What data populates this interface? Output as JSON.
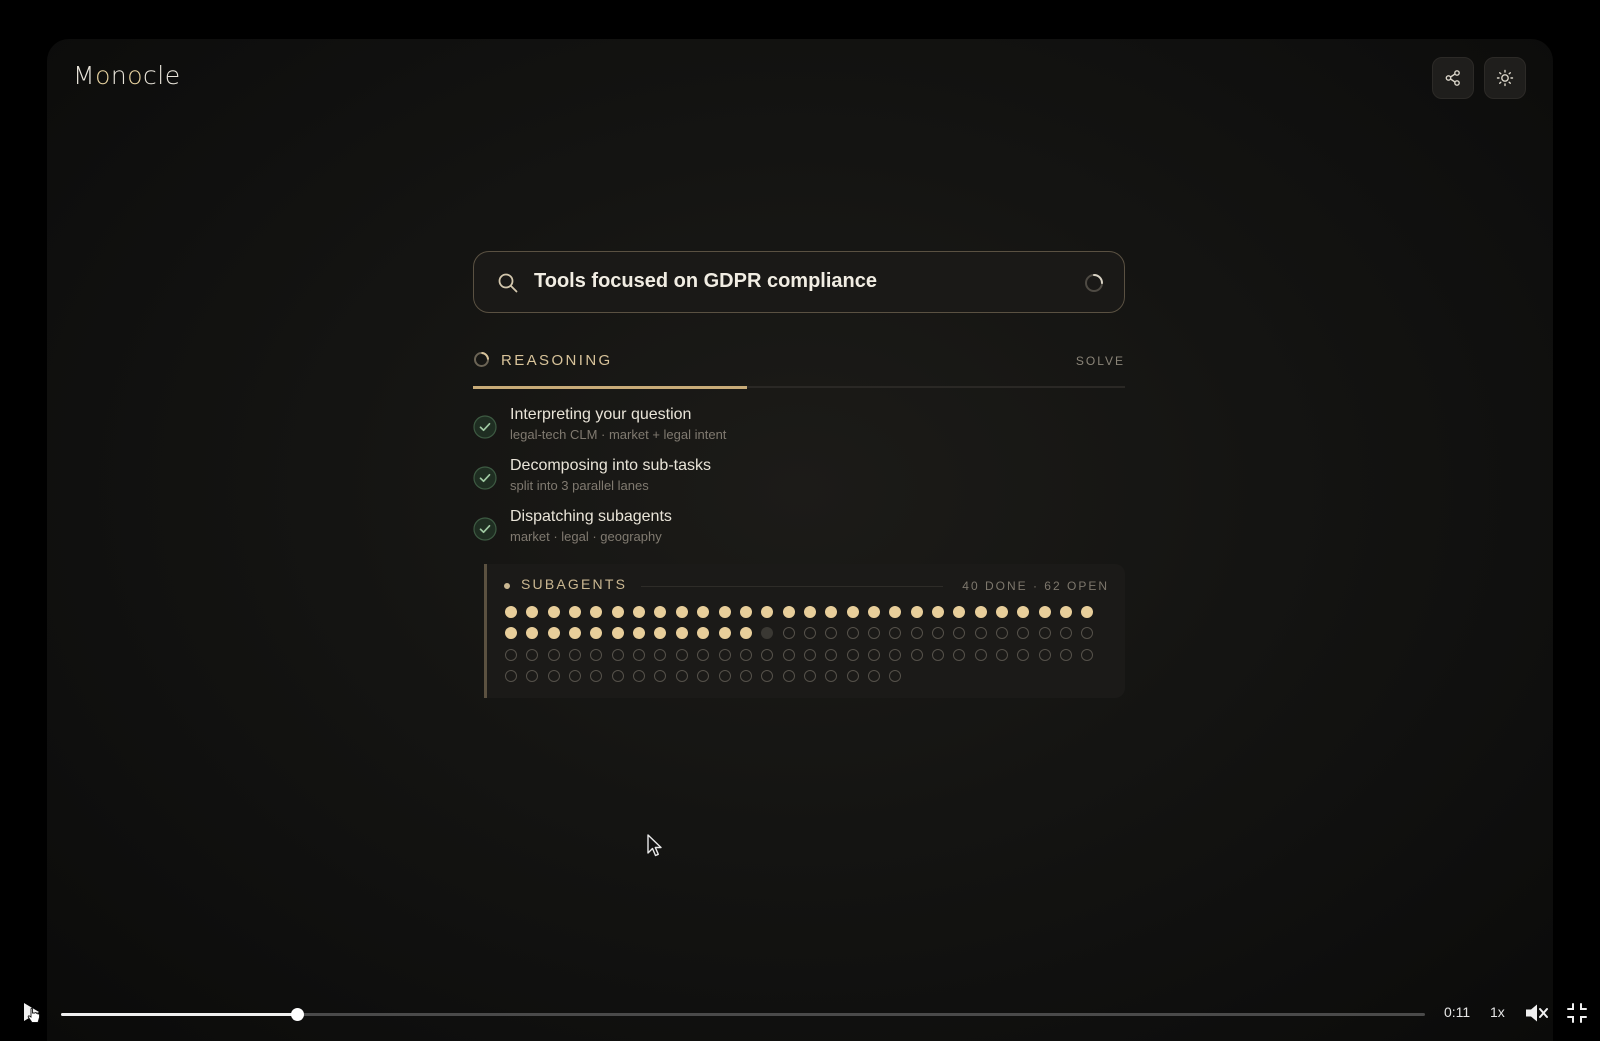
{
  "app": {
    "name": "Monocle",
    "share_button_icon": "share-icon",
    "theme_button_icon": "sun-icon",
    "accent_color": "#c8ab78"
  },
  "search": {
    "query": "Tools focused on GDPR compliance",
    "icon": "search-icon",
    "status_icon": "loading-spinner-icon"
  },
  "reasoning": {
    "label": "REASONING",
    "next_stage_label": "SOLVE",
    "progress_fraction": 0.42
  },
  "steps": [
    {
      "title": "Interpreting your question",
      "detail": "legal-tech CLM · market + legal intent",
      "status": "done"
    },
    {
      "title": "Decomposing into sub-tasks",
      "detail": "split into 3 parallel lanes",
      "status": "done"
    },
    {
      "title": "Dispatching subagents",
      "detail": "market · legal · geography",
      "status": "done"
    }
  ],
  "subagents": {
    "label": "SUBAGENTS",
    "count_text": "40 DONE · 62 OPEN",
    "done": 40,
    "running": 1,
    "open": 62,
    "per_row": 28
  },
  "video": {
    "time": "0:11",
    "speed": "1x",
    "progress_fraction": 0.173,
    "play_icon": "play-icon",
    "mute_icon": "muted-speaker-icon",
    "fullscreen_icon": "exit-fullscreen-icon"
  }
}
